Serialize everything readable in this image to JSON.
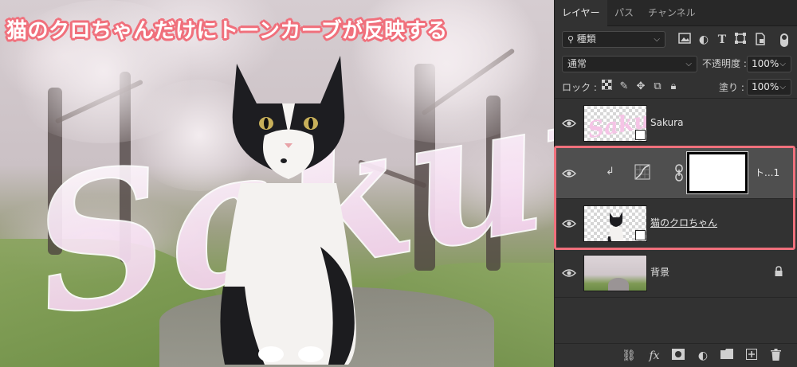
{
  "banner": {
    "text": "猫のクロちゃんだけにトーンカーブが反映する",
    "outline_color": "#f0707c"
  },
  "canvas": {
    "overlay_text": "Sakura"
  },
  "panel": {
    "tabs": [
      {
        "label": "レイヤー",
        "active": true
      },
      {
        "label": "パス",
        "active": false
      },
      {
        "label": "チャンネル",
        "active": false
      }
    ],
    "filter": {
      "search_icon": "search-icon",
      "kind_label": "種類",
      "icons": [
        "image-filter-icon",
        "adjustment-filter-icon",
        "text-filter-icon",
        "shape-filter-icon",
        "smart-object-filter-icon"
      ]
    },
    "blend": {
      "mode": "通常",
      "opacity_label": "不透明度 :",
      "opacity_value": "100%"
    },
    "lock": {
      "label": "ロック :",
      "fill_label": "塗り :",
      "fill_value": "100%"
    },
    "layers": [
      {
        "name": "Sakura",
        "type": "smart-object",
        "visible": true
      },
      {
        "name": "ト...1",
        "type": "adjustment-curves",
        "visible": true,
        "selected": true,
        "clipped": true
      },
      {
        "name": "猫のクロちゃん",
        "type": "smart-object",
        "visible": true,
        "underlined": true
      },
      {
        "name": "背景",
        "type": "background",
        "visible": true,
        "locked": true
      }
    ],
    "highlight_color": "#f0707c",
    "bottom_icons": [
      "link-layers-icon",
      "fx-icon",
      "add-mask-icon",
      "new-adjustment-icon",
      "new-group-icon",
      "new-layer-icon",
      "trash-icon"
    ]
  }
}
